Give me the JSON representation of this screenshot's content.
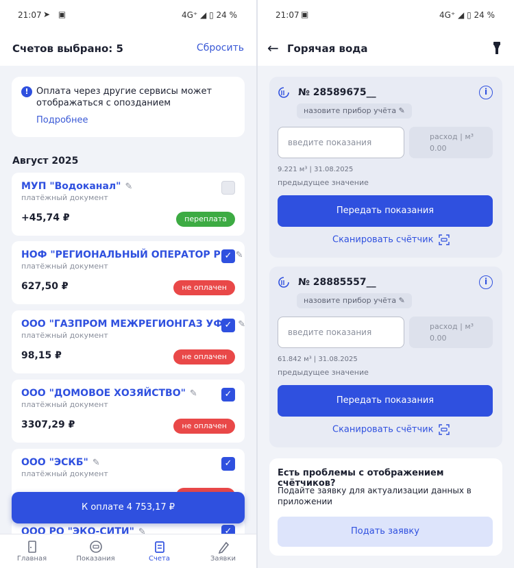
{
  "left": {
    "status": {
      "time": "21:07",
      "network": "4G⁺",
      "battery": "24 %"
    },
    "header": {
      "title": "Счетов выбрано: 5",
      "reset": "Сбросить"
    },
    "notice": {
      "text": "Оплата через другие сервисы может отображаться с опозданием",
      "link": "Подробнее"
    },
    "month": "Август 2025",
    "bills": [
      {
        "name": "МУП \"Водоканал\"",
        "doc": "платёжный документ",
        "amount": "+45,74 ₽",
        "status": "переплата",
        "checked": false
      },
      {
        "name": "НОФ \"РЕГИОНАЛЬНЫЙ ОПЕРАТОР Р...",
        "doc": "платёжный документ",
        "amount": "627,50 ₽",
        "status": "не оплачен",
        "checked": true
      },
      {
        "name": "ООО \"ГАЗПРОМ МЕЖРЕГИОНГАЗ УФ...",
        "doc": "платёжный документ",
        "amount": "98,15 ₽",
        "status": "не оплачен",
        "checked": true
      },
      {
        "name": "ООО \"ДОМОВОЕ ХОЗЯЙСТВО\"",
        "doc": "платёжный документ",
        "amount": "3307,29 ₽",
        "status": "не оплачен",
        "checked": true
      },
      {
        "name": "ООО \"ЭСКБ\"",
        "doc": "платёжный документ",
        "amount": "",
        "status": "",
        "checked": true
      },
      {
        "name": "ООО РО \"ЭКО-СИТИ\"",
        "doc": "",
        "amount": "",
        "status": "",
        "checked": true
      }
    ],
    "pay_button": "К оплате 4 753,17 ₽",
    "tabs": [
      {
        "label": "Главная",
        "icon": "home-icon"
      },
      {
        "label": "Показания",
        "icon": "meter-readings-icon"
      },
      {
        "label": "Счета",
        "icon": "bills-icon",
        "active": true
      },
      {
        "label": "Заявки",
        "icon": "pencil-request-icon"
      }
    ]
  },
  "right": {
    "status": {
      "time": "21:07",
      "network": "4G⁺",
      "battery": "24 %"
    },
    "header": {
      "title": "Горячая вода"
    },
    "meters": [
      {
        "number": "№ 28589675__",
        "name_chip": "назовите прибор учёта",
        "input_placeholder": "введите показания",
        "usage_label": "расход | м³",
        "usage_value": "0.00",
        "previous": "9.221 м³ | 31.08.2025",
        "previous_label": "предыдущее значение",
        "send": "Передать показания",
        "scan": "Сканировать счётчик"
      },
      {
        "number": "№ 28885557__",
        "name_chip": "назовите прибор учёта",
        "input_placeholder": "введите показания",
        "usage_label": "расход | м³",
        "usage_value": "0.00",
        "previous": "61.842 м³ | 31.08.2025",
        "previous_label": "предыдущее значение",
        "send": "Передать показания",
        "scan": "Сканировать счётчик"
      }
    ],
    "problem": {
      "heading": "Есть проблемы с отображением счётчиков?",
      "text": "Подайте заявку для актуализации данных в приложении",
      "button": "Подать заявку"
    }
  },
  "colors": {
    "accent": "#2f50df",
    "danger": "#e94848",
    "success": "#3dab43",
    "background": "#f1f3f8"
  }
}
